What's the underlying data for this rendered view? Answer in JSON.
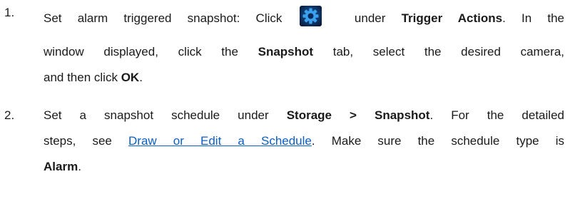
{
  "steps": [
    {
      "number": "1.",
      "line1": {
        "prefix": "Set alarm triggered snapshot: Click",
        "icon": "settings-gear-icon",
        "after_icon": " under ",
        "bold1": "Trigger Actions",
        "suffix": ". In the"
      },
      "line2": {
        "prefix": "window displayed, click the ",
        "bold1": "Snapshot",
        "suffix": " tab, select the desired camera,"
      },
      "line3": {
        "prefix": "and then click ",
        "bold1": "OK",
        "suffix": "."
      }
    },
    {
      "number": "2.",
      "line1": {
        "prefix": "Set a snapshot schedule under ",
        "bold1": "Storage > Snapshot",
        "suffix": ". For the detailed"
      },
      "line2": {
        "prefix": "steps, see ",
        "link": "Draw or Edit a Schedule",
        "suffix": ". Make sure the schedule type is"
      },
      "line3": {
        "bold1": "Alarm",
        "suffix": "."
      }
    }
  ],
  "colors": {
    "text": "#1a1a1a",
    "link": "#0b5fc6",
    "icon_dark": "#0a2a5c",
    "icon_light": "#2f8fe6"
  }
}
